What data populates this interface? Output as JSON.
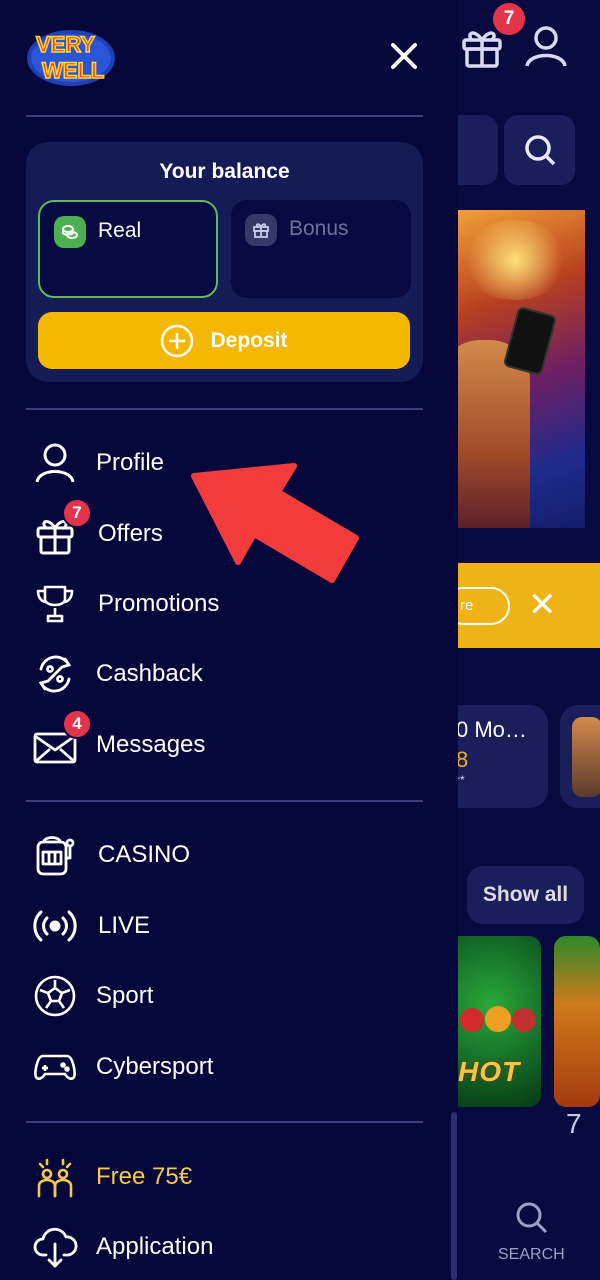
{
  "background": {
    "gift_badge": "7",
    "game_card": {
      "title": "0 Mo…",
      "value": "8",
      "note": "r*"
    },
    "yellow_bar_pill": "re",
    "show_all": "Show all",
    "game_label": "HOT",
    "bottom_nav_search": "SEARCH",
    "partial_number": "7"
  },
  "drawer": {
    "logo_text": "VERY WELL",
    "balance": {
      "title": "Your balance",
      "real_label": "Real",
      "bonus_label": "Bonus",
      "deposit_label": "Deposit"
    },
    "account_menu": [
      {
        "label": "Profile",
        "icon": "user-icon",
        "badge": null
      },
      {
        "label": "Offers",
        "icon": "gift-icon",
        "badge": "7"
      },
      {
        "label": "Promotions",
        "icon": "trophy-icon",
        "badge": null
      },
      {
        "label": "Cashback",
        "icon": "cashback-icon",
        "badge": null
      },
      {
        "label": "Messages",
        "icon": "envelope-icon",
        "badge": "4"
      }
    ],
    "section_menu": [
      {
        "label": "CASINO",
        "icon": "slot-machine-icon"
      },
      {
        "label": "LIVE",
        "icon": "live-broadcast-icon"
      },
      {
        "label": "Sport",
        "icon": "soccer-ball-icon"
      },
      {
        "label": "Cybersport",
        "icon": "gamepad-icon"
      }
    ],
    "extra_menu": [
      {
        "label": "Free 75€",
        "icon": "celebration-icon"
      },
      {
        "label": "Application",
        "icon": "download-cloud-icon"
      }
    ]
  },
  "colors": {
    "drawer_bg": "#05073a",
    "accent_yellow": "#f5b800",
    "real_green": "#4caf50",
    "badge_red": "#e3344c",
    "promo_text": "#f5c94a",
    "annotation_red": "#f23b3b"
  }
}
